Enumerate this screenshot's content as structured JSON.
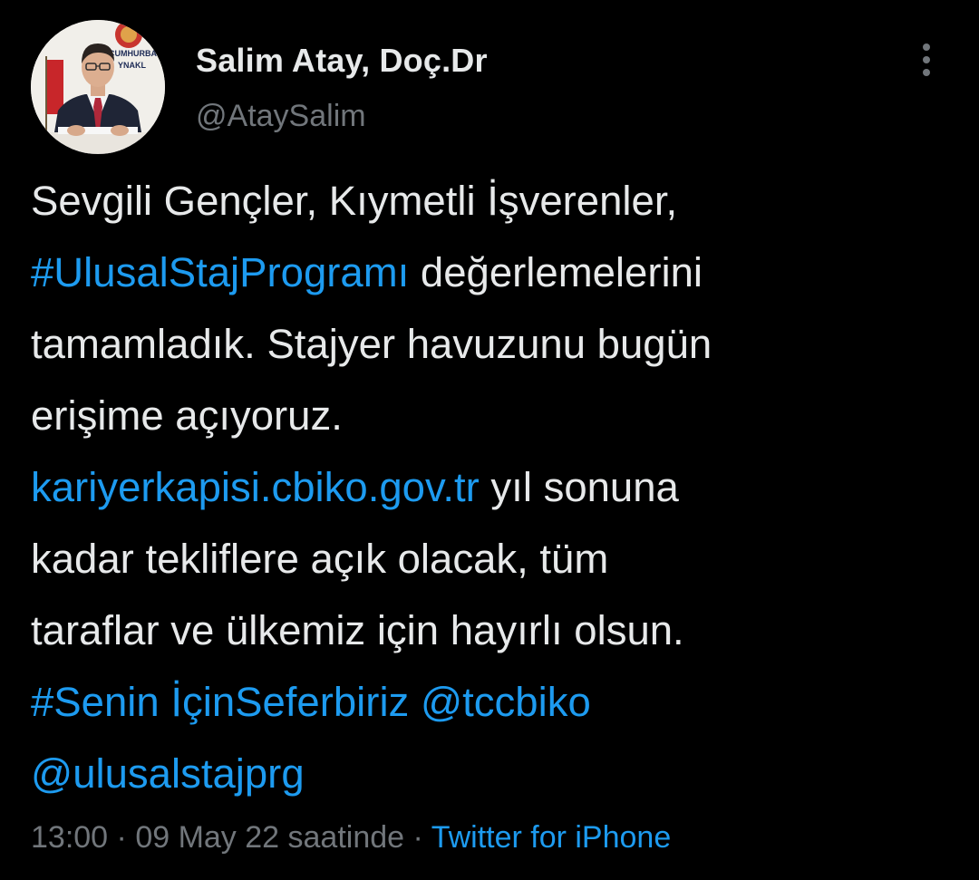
{
  "tweet": {
    "author": {
      "display_name": "Salim Atay, Doç.Dr",
      "handle": "@AtaySalim",
      "avatar_sign_text": "CUMHURBA\nYNAKL"
    },
    "more_icon": "vertical-ellipsis-icon",
    "body_lines": [
      [
        {
          "text": "Sevgili Gençler, Kıymetli İşverenler,"
        }
      ],
      [
        {
          "text": "#UlusalStajProgramı",
          "link": true
        },
        {
          "text": " değerlemelerini"
        }
      ],
      [
        {
          "text": "tamamladık. Stajyer havuzunu bugün"
        }
      ],
      [
        {
          "text": "erişime açıyoruz."
        }
      ],
      [
        {
          "text": "kariyerkapisi.cbiko.gov.tr",
          "link": true
        },
        {
          "text": " yıl sonuna"
        }
      ],
      [
        {
          "text": "kadar tekliflere açık olacak, tüm"
        }
      ],
      [
        {
          "text": "taraflar ve ülkemiz için hayırlı olsun."
        }
      ],
      [
        {
          "text": "#Senin İçinSeferbiriz",
          "link": true
        },
        {
          "text": " "
        },
        {
          "text": "@tccbiko",
          "link": true
        }
      ],
      [
        {
          "text": "@ulusalstajprg",
          "link": true
        }
      ]
    ],
    "meta": {
      "time": "13:00",
      "separator": " · ",
      "date": "09 May 22 saatinde",
      "source": "Twitter for iPhone"
    },
    "colors": {
      "background": "#000000",
      "text": "#e7e9ea",
      "secondary_text": "#71767b",
      "link": "#1d9bf0"
    }
  }
}
